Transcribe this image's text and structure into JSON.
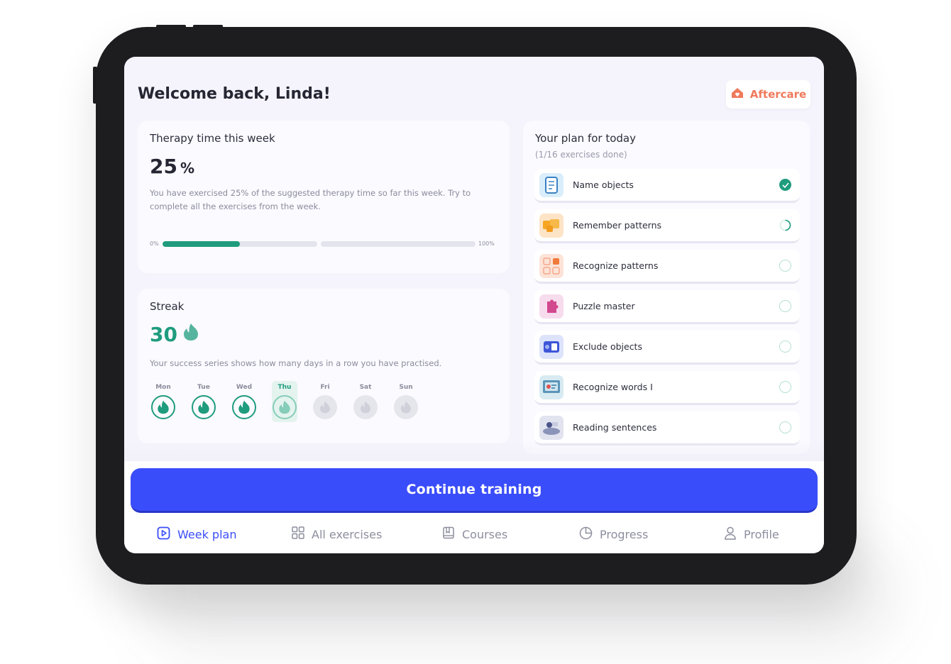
{
  "header": {
    "title": "Welcome back, Linda!",
    "aftercare_label": "Aftercare"
  },
  "therapy": {
    "title": "Therapy time this week",
    "percent": "25",
    "percent_sign": "%",
    "percent_value": 25,
    "description_line1": "You have exercised 25% of the suggested therapy time so far this week. Try to",
    "description_line2": "complete all the exercises from the week.",
    "min_label": "0%",
    "max_label": "100%"
  },
  "streak": {
    "title": "Streak",
    "count": "30",
    "description": "Your success series shows how many days in a row you have practised.",
    "days": [
      {
        "label": "Mon",
        "state": "done"
      },
      {
        "label": "Tue",
        "state": "done"
      },
      {
        "label": "Wed",
        "state": "done"
      },
      {
        "label": "Thu",
        "state": "today"
      },
      {
        "label": "Fri",
        "state": "off"
      },
      {
        "label": "Sat",
        "state": "off"
      },
      {
        "label": "Sun",
        "state": "off"
      }
    ]
  },
  "plan": {
    "title": "Your plan for today",
    "subtitle": "(1/16 exercises done)",
    "exercises": [
      {
        "label": "Name objects",
        "status": "done",
        "icon": "name-objects-icon"
      },
      {
        "label": "Remember patterns",
        "status": "in-progress",
        "icon": "remember-patterns-icon"
      },
      {
        "label": "Recognize patterns",
        "status": "todo",
        "icon": "recognize-patterns-icon"
      },
      {
        "label": "Puzzle master",
        "status": "todo",
        "icon": "puzzle-master-icon"
      },
      {
        "label": "Exclude objects",
        "status": "todo",
        "icon": "exclude-objects-icon"
      },
      {
        "label": "Recognize words I",
        "status": "todo",
        "icon": "recognize-words-icon"
      },
      {
        "label": "Reading sentences",
        "status": "todo",
        "icon": "reading-sentences-icon"
      }
    ]
  },
  "cta": {
    "continue_label": "Continue training"
  },
  "nav": {
    "items": [
      {
        "label": "Week plan",
        "icon": "play-square-icon",
        "active": true
      },
      {
        "label": "All exercises",
        "icon": "grid-icon",
        "active": false
      },
      {
        "label": "Courses",
        "icon": "book-icon",
        "active": false
      },
      {
        "label": "Progress",
        "icon": "pie-chart-icon",
        "active": false
      },
      {
        "label": "Profile",
        "icon": "user-icon",
        "active": false
      }
    ]
  },
  "colors": {
    "accent": "#3a4dfa",
    "success": "#1f9c7e",
    "aftercare": "#f07a5c",
    "background": "#f5f4fc"
  }
}
